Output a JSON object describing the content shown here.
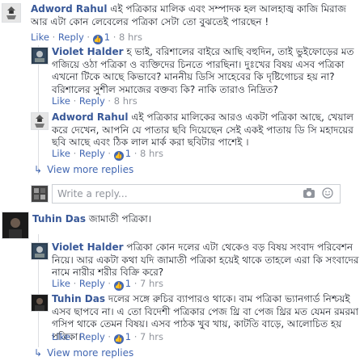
{
  "thread": [
    {
      "id": "c1",
      "author": "Adword Rahul",
      "text": "এই পত্রিকার মালিক এবং সম্পাদক হল আলহাজ্ব কাজি মিরাজ আর এটা কোন লেবেলের পত্রিকা সেটা তো বুঝতেই পারছেন !",
      "like": "Like",
      "reply": "Reply",
      "likes": "1",
      "time": "8 hrs"
    },
    {
      "id": "r1",
      "author": "Violet Halder",
      "text": "হ ভাই, বরিশালের বাইরে আছি বহুদিন, তাই ভুইফোড়ের মত গজিয়ে ওঠা পত্রিকা ও ব্যক্তিদের চিনতে পারছিনা। দুঃখের বিষয় এসব পত্রিকা এখনো টিকে আছে কিভাবে? মাননীয় ডিসি সাহেবের কি দৃষ্টিগোচর হয় না? বরিশালের সুশীল সমাজের বক্তব্য কি? নাকি তারাও নিদ্রিত?",
      "like": "Like",
      "reply": "Reply",
      "time": "8 hrs"
    },
    {
      "id": "r2",
      "author": "Adword Rahul",
      "text": "এই পত্রিকার মালিকের আরও একটা পত্রিকা আছে, খেয়াল করে দেখেন, আপনি যে পাতার ছবি দিয়েছেন সেই একই পাতায় ডি সি মহাদয়ের ছবি আছে এবং ঠিক লাল মার্ক করা ছবিটার পাশেই ।",
      "like": "Like",
      "reply": "Reply",
      "likes": "1",
      "time": "8 hrs"
    },
    {
      "id": "c2",
      "author": "Tuhin Das",
      "text": "জামাতী পত্রিকা।"
    },
    {
      "id": "r3",
      "author": "Violet Halder",
      "text": "পত্রিকা কোন দলের এটা থেকেও বড় বিষয় সংবাদ পরিবেশন নিয়ে। আর একটা কথা যদি জামাতী পত্রিকা হয়েই থাকে তাহলে এরা কি সংবাদের নামে নারীর শরীর বিক্রি করে?",
      "like": "Like",
      "reply": "Reply",
      "likes": "1",
      "time": "7 hrs"
    },
    {
      "id": "r4",
      "author": "Tuhin Das",
      "text": "দলের সঙ্গে রুচির ব্যাপারও থাকে। বাম পত্রিকা ভ্যানগার্ড নিশ্চয়ই এসব ছাপবে না। এ তো বিদেশী পত্রিকার পেজ থ্রি বা পেজ থ্রির মত যেমন রমরমা গসিপ থাকে তেমন বিষয়। এসব পাঠক খুব খায়, কাটতি বাড়ে, আলোচিত হয় পত্রিকা।",
      "like": "Like",
      "reply": "Reply",
      "likes": "1",
      "time": "7 hrs"
    }
  ],
  "view_more_1": "View more replies",
  "view_more_2": "View more replies",
  "reply_placeholder": "Write a reply...",
  "colors": {
    "link": "#385898",
    "action": "#4267b2",
    "muted": "#90949c",
    "border": "#dddfe2"
  },
  "icons": [
    "camera-icon",
    "emoji-icon",
    "reply-arrow-icon",
    "like-badge-icon"
  ]
}
